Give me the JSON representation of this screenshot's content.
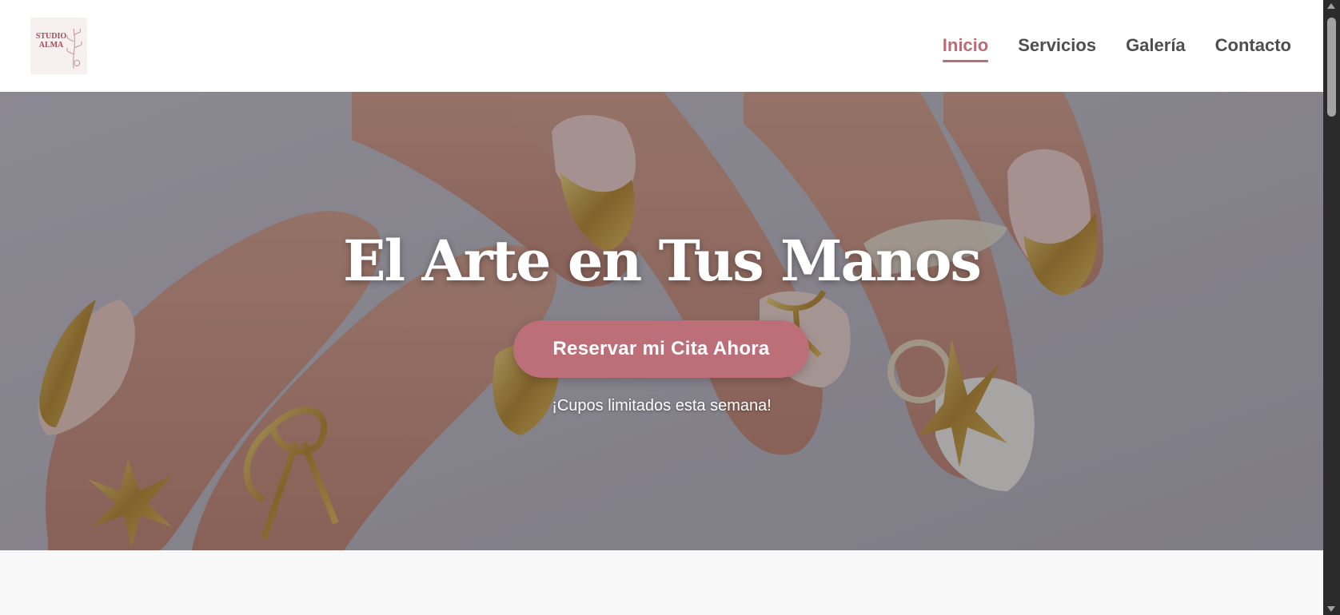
{
  "brand": {
    "logo_line1": "STUDIO",
    "logo_line2": "ALMA",
    "accent_color": "#b86d78"
  },
  "nav": {
    "items": [
      {
        "label": "Inicio",
        "active": true
      },
      {
        "label": "Servicios",
        "active": false
      },
      {
        "label": "Galería",
        "active": false
      },
      {
        "label": "Contacto",
        "active": false
      }
    ]
  },
  "hero": {
    "title": "El Arte en Tus Manos",
    "cta_label": "Reservar mi Cita Ahora",
    "note": "¡Cupos limitados esta semana!",
    "cta_color": "#bc6e79"
  }
}
